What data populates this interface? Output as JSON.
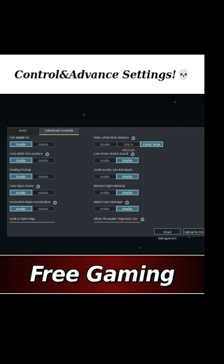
{
  "header": {
    "title": "Control&Advance Settings!",
    "skull_icon": "💀"
  },
  "tabs": [
    {
      "label": "Basic Controls",
      "active": false
    },
    {
      "label": "Advanced Controls",
      "active": true
    }
  ],
  "left_settings": [
    {
      "label": "Aim assist",
      "info": false,
      "options": [
        "Enable",
        "Disable"
      ],
      "selected": 0
    },
    {
      "label": "Auto-Mark Hit Locations",
      "info": true,
      "options": [
        "Enable",
        "Disable"
      ],
      "selected": 0
    },
    {
      "label": "Healing Prompt",
      "info": false,
      "options": [
        "Enable",
        "Disable"
      ],
      "selected": 0
    },
    {
      "label": "Auto-Open Doors",
      "info": true,
      "options": [
        "Enable",
        "Disable"
      ],
      "selected": 0
    },
    {
      "label": "Horizontal Swipe Acceleration",
      "info": true,
      "options": [
        "Enable",
        "Disable"
      ],
      "selected": 0
    },
    {
      "label": "Hold to Open Map",
      "info": false,
      "options": [],
      "selected": null
    }
  ],
  "right_settings": [
    {
      "label": "Hide Lethal Slide Markers",
      "info": true,
      "options": [
        "Disable",
        "Only in Aftermath",
        "Classic Mode"
      ],
      "selected": 2
    },
    {
      "label": "Low Ammo Notice Sound",
      "info": true,
      "options": [
        "Enable",
        "Disable"
      ],
      "selected": 1
    },
    {
      "label": "Continuously Use Bandages",
      "info": false,
      "options": [
        "Enable",
        "Disable"
      ],
      "selected": 1
    },
    {
      "label": "Blocked Sight Warning",
      "info": false,
      "options": [
        "Enable",
        "Disable"
      ],
      "selected": 1
    },
    {
      "label": "Match Auto Message",
      "info": true,
      "options": [
        "Enable",
        "Disable"
      ],
      "selected": 1
    },
    {
      "label": "Show Throwable Trajectory Line",
      "info": true,
      "options": [],
      "selected": null
    }
  ],
  "bottom_buttons": {
    "cloud": "Cloud Management",
    "upload": "Upload to Clo"
  },
  "banner": {
    "text": "Free Gaming"
  },
  "colors": {
    "selected_button": "#3f6b78",
    "banner_red": "#6b0808",
    "panel": "#2b3036"
  }
}
